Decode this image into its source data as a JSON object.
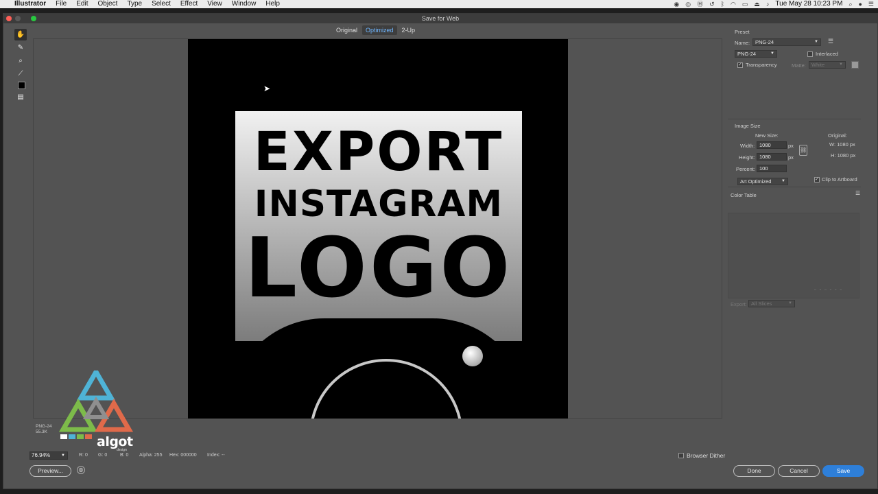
{
  "menubar": {
    "apple": "",
    "app": "Illustrator",
    "items": [
      "File",
      "Edit",
      "Object",
      "Type",
      "Select",
      "Effect",
      "View",
      "Window",
      "Help"
    ],
    "clock": "Tue May 28  10:23 PM"
  },
  "window": {
    "title": "Save for Web"
  },
  "view_tabs": [
    "Original",
    "Optimized",
    "2-Up"
  ],
  "artwork": {
    "line1": "EXPORT",
    "line2": "INSTAGRAM",
    "line3": "LOGO"
  },
  "preset": {
    "section_label": "Preset",
    "name_label": "Name:",
    "name_value": "PNG-24",
    "format_value": "PNG-24",
    "interlaced_label": "Interlaced",
    "interlaced_checked": false,
    "transparency_label": "Transparency",
    "transparency_checked": true,
    "matte_label": "Matte:",
    "matte_value": "White"
  },
  "image_size": {
    "section_label": "Image Size",
    "new_size_label": "New Size:",
    "original_label": "Original:",
    "width_label": "Width:",
    "width_value": "1080",
    "height_label": "Height:",
    "height_value": "1080",
    "unit": "px",
    "percent_label": "Percent:",
    "percent_value": "100",
    "orig_w": "W:  1080 px",
    "orig_h": "H:  1080 px",
    "quality_value": "Art Optimized",
    "clip_label": "Clip to Artboard",
    "clip_checked": true
  },
  "color_table": {
    "label": "Color Table"
  },
  "export": {
    "label": "Export:",
    "value": "All Slices"
  },
  "status": {
    "format": "PNG-24",
    "size": "55.3K",
    "zoom": "76.94%",
    "r": "R: 0",
    "g": "G: 0",
    "b": "B: 0",
    "alpha": "Alpha: 255",
    "hex": "Hex: 000000",
    "index": "Index: --"
  },
  "browser_dither": {
    "label": "Browser Dither",
    "checked": false
  },
  "buttons": {
    "preview": "Preview...",
    "done": "Done",
    "cancel": "Cancel",
    "save": "Save"
  },
  "watermark": {
    "name": "algot",
    "sub": "design"
  },
  "colors": {
    "accent": "#2e7fd9",
    "tab_active": "#6fb6ff",
    "panel_bg": "#535353"
  }
}
